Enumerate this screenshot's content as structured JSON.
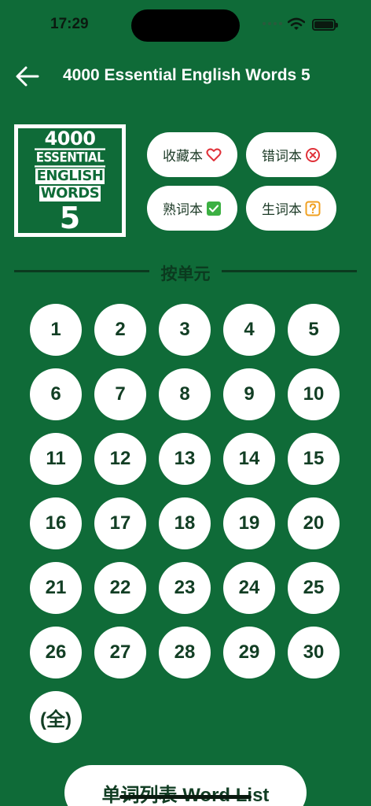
{
  "status_bar": {
    "time": "17:29"
  },
  "header": {
    "title": "4000 Essential English Words 5",
    "back_icon": "arrow-left-icon"
  },
  "book_cover": {
    "line1": "4000",
    "line2": "ESSENTIAL",
    "line3": "ENGLISH",
    "line4": "WORDS",
    "line5": "5"
  },
  "collections": {
    "favorites": {
      "label": "收藏本",
      "icon": "heart-icon"
    },
    "mistakes": {
      "label": "错词本",
      "icon": "x-circle-icon"
    },
    "known": {
      "label": "熟词本",
      "icon": "check-box-icon"
    },
    "new_words": {
      "label": "生词本",
      "icon": "question-box-icon"
    }
  },
  "section": {
    "by_unit_label": "按单元"
  },
  "units": [
    "1",
    "2",
    "3",
    "4",
    "5",
    "6",
    "7",
    "8",
    "9",
    "10",
    "11",
    "12",
    "13",
    "14",
    "15",
    "16",
    "17",
    "18",
    "19",
    "20",
    "21",
    "22",
    "23",
    "24",
    "25",
    "26",
    "27",
    "28",
    "29",
    "30",
    "(全)"
  ],
  "bottom": {
    "word_list_label": "单词列表 Word List"
  },
  "colors": {
    "background": "#0f6b38",
    "button_bg": "#ffffff",
    "button_text": "#123e24",
    "heart": "#e0323a",
    "check": "#3cb043",
    "question": "#f0a020"
  }
}
